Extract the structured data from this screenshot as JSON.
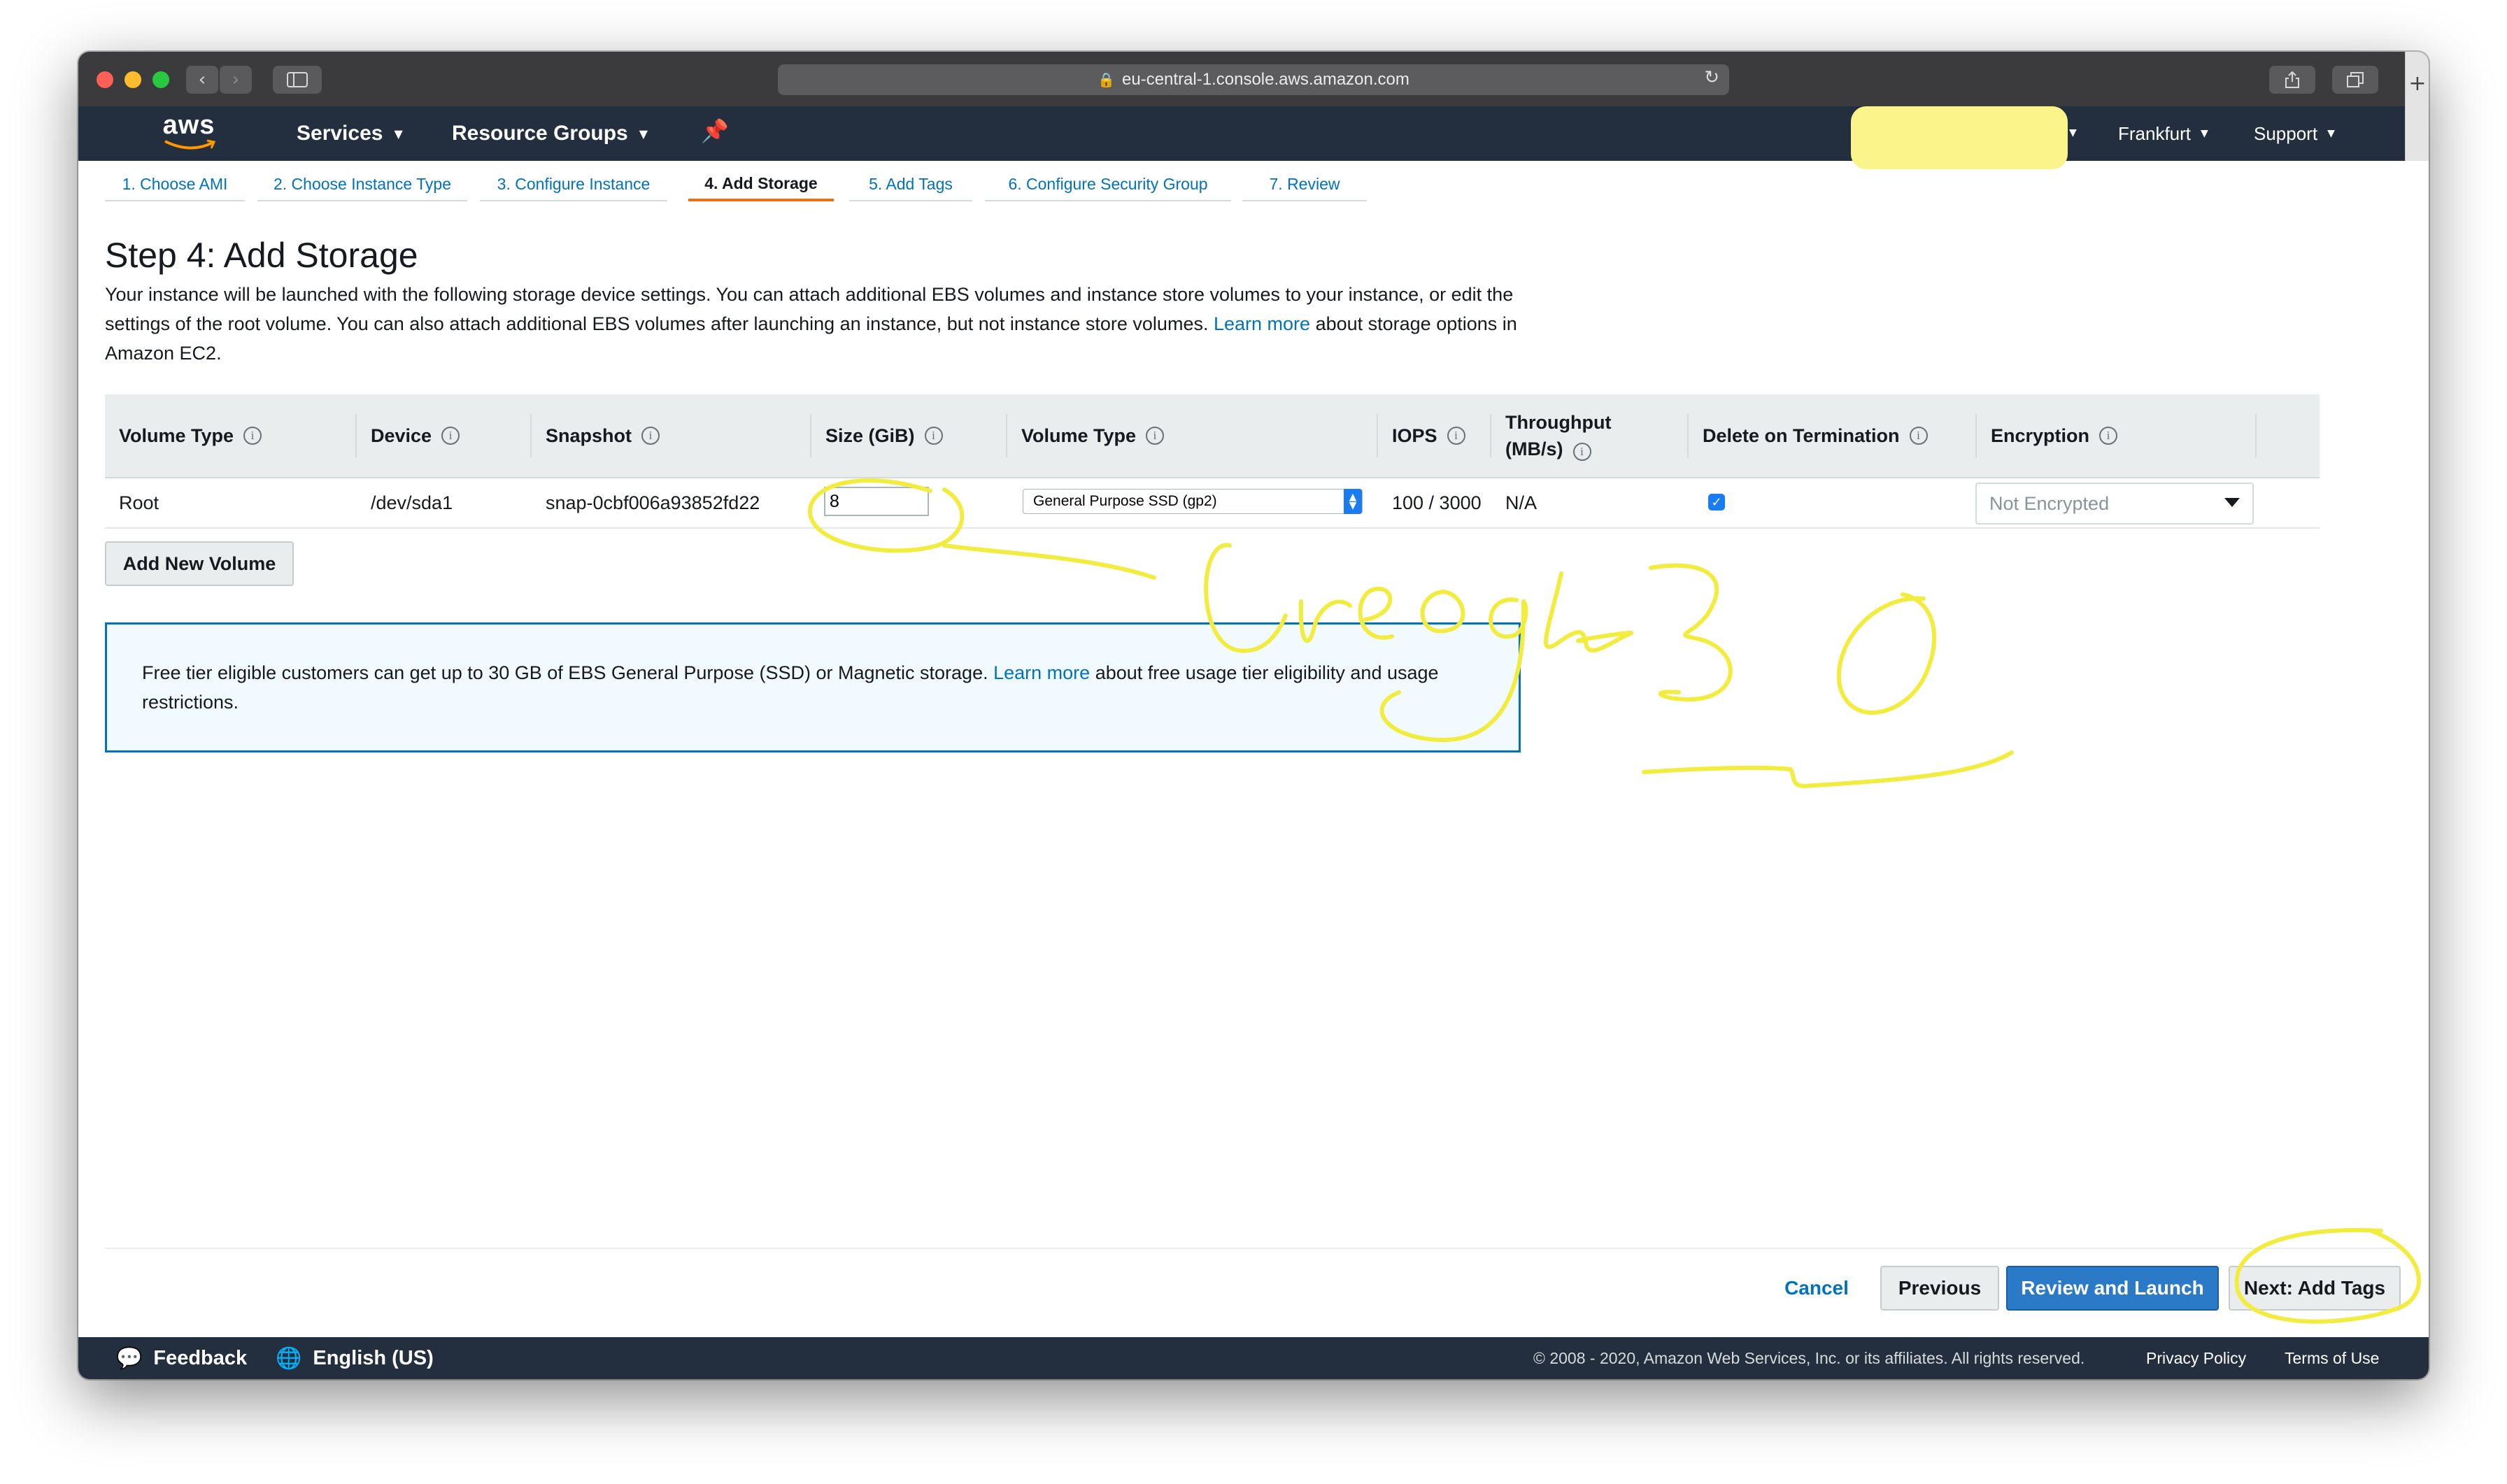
{
  "browser": {
    "url": "eu-central-1.console.aws.amazon.com",
    "back_icon": "chevron-left-icon",
    "forward_icon": "chevron-right-icon"
  },
  "nav": {
    "logo": "aws",
    "services": "Services",
    "resource_groups": "Resource Groups",
    "region": "Frankfurt",
    "support": "Support"
  },
  "wizard": {
    "tabs": [
      {
        "label": "1. Choose AMI"
      },
      {
        "label": "2. Choose Instance Type"
      },
      {
        "label": "3. Configure Instance"
      },
      {
        "label": "4. Add Storage",
        "active": true
      },
      {
        "label": "5. Add Tags"
      },
      {
        "label": "6. Configure Security Group"
      },
      {
        "label": "7. Review"
      }
    ]
  },
  "page": {
    "title": "Step 4: Add Storage",
    "description_main": "Your instance will be launched with the following storage device settings. You can attach additional EBS volumes and instance store volumes to your instance, or edit the settings of the root volume. You can also attach additional EBS volumes after launching an instance, but not instance store volumes.",
    "learn_more": "Learn more",
    "description_tail": "about storage options in Amazon EC2."
  },
  "table": {
    "headers": {
      "volume_type": "Volume Type",
      "device": "Device",
      "snapshot": "Snapshot",
      "size": "Size (GiB)",
      "volume_type2": "Volume Type",
      "iops": "IOPS",
      "throughput_1": "Throughput",
      "throughput_2": "(MB/s)",
      "delete": "Delete on Termination",
      "encryption": "Encryption"
    },
    "row": {
      "volume_type": "Root",
      "device": "/dev/sda1",
      "snapshot": "snap-0cbf006a93852fd22",
      "size": "8",
      "volume_type_select": "General Purpose SSD (gp2)",
      "iops": "100 / 3000",
      "throughput": "N/A",
      "delete_on_termination": true,
      "encryption": "Not Encrypted"
    }
  },
  "add_volume": "Add New Volume",
  "notice": {
    "text": "Free tier eligible customers can get up to 30 GB of EBS General Purpose (SSD) or Magnetic storage.",
    "learn_more": "Learn more",
    "tail": "about free usage tier eligibility and usage restrictions."
  },
  "actions": {
    "cancel": "Cancel",
    "previous": "Previous",
    "review": "Review and Launch",
    "next": "Next: Add Tags"
  },
  "footer": {
    "feedback": "Feedback",
    "language": "English (US)",
    "copyright": "© 2008 - 2020, Amazon Web Services, Inc. or its affiliates. All rights reserved.",
    "privacy": "Privacy Policy",
    "terms": "Terms of Use"
  },
  "colors": {
    "aws_nav": "#232f3e",
    "link": "#0073bb",
    "active_tab": "#ec7211",
    "primary_button": "#2a7ac8",
    "annotation": "#f4ee42",
    "redaction": "#fbf48b"
  }
}
